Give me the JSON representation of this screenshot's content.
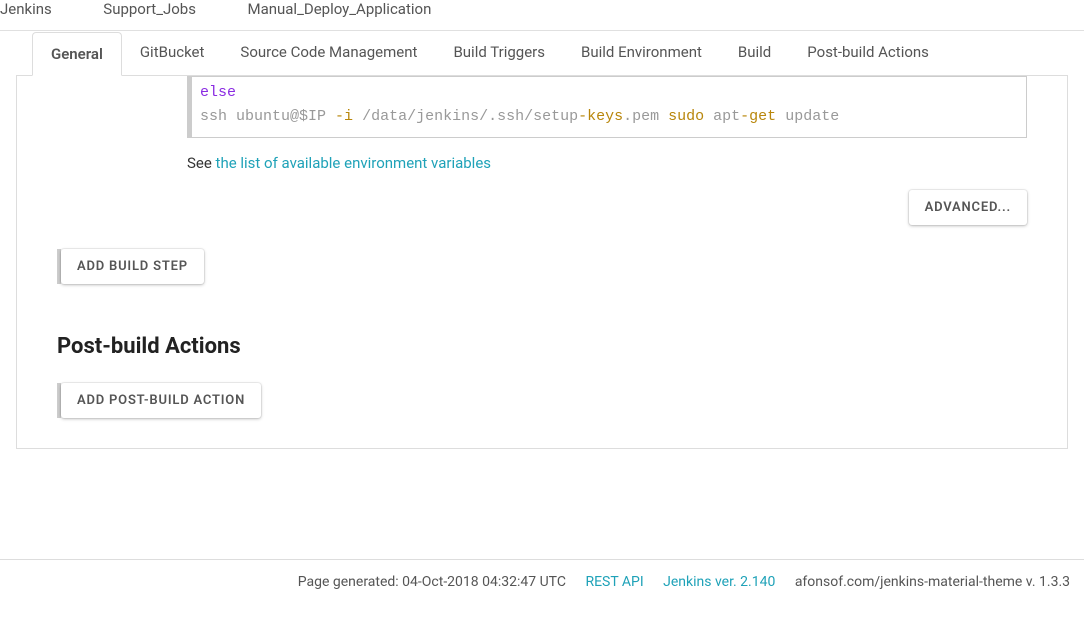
{
  "breadcrumb": [
    "Jenkins",
    "Support_Jobs",
    "Manual_Deploy_Application"
  ],
  "tabs": [
    "General",
    "GitBucket",
    "Source Code Management",
    "Build Triggers",
    "Build Environment",
    "Build",
    "Post-build Actions"
  ],
  "activeTab": 0,
  "code": {
    "l1_kw": "else",
    "l2_a": "ssh ",
    "l2_b": "ubuntu@$IP ",
    "l2_c": "-i ",
    "l2_d": "/data/jenkins/.ssh/setup",
    "l2_e": "-keys",
    "l2_f": ".pem ",
    "l2_g": "sudo ",
    "l2_h": "apt",
    "l2_i": "-get ",
    "l2_j": "update"
  },
  "hint": {
    "pre": "See ",
    "link": "the list of available environment variables"
  },
  "buttons": {
    "advanced": "Advanced...",
    "addBuild": "Add build step",
    "addPost": "Add post-build action"
  },
  "section": {
    "postbuild": "Post-build Actions"
  },
  "footer": {
    "generated": "Page generated: 04-Oct-2018 04:32:47 UTC",
    "restapi": "REST API",
    "version": "Jenkins ver. 2.140",
    "theme": "afonsof.com/jenkins-material-theme v. 1.3.3"
  }
}
